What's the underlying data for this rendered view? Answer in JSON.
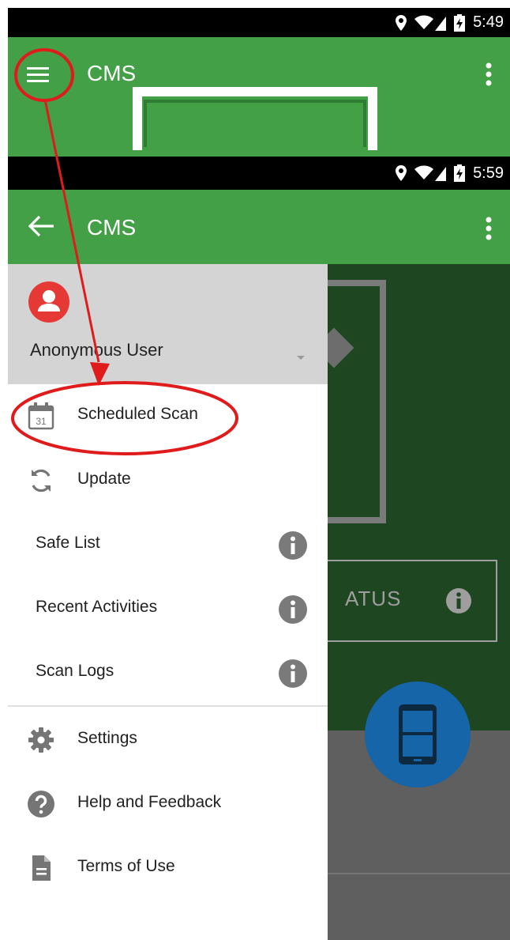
{
  "screen_top": {
    "status_time": "5:49",
    "title": "CMS"
  },
  "screen_bottom": {
    "status_time": "5:59",
    "title": "CMS",
    "background_status_text": "ATUS"
  },
  "drawer": {
    "user_name": "Anonymous User",
    "calendar_day": "31",
    "items": [
      {
        "label": "Scheduled Scan",
        "icon": "calendar-icon"
      },
      {
        "label": "Update",
        "icon": "refresh-icon"
      },
      {
        "label": "Safe List",
        "icon": "info-icon"
      },
      {
        "label": "Recent Activities",
        "icon": "info-icon"
      },
      {
        "label": "Scan Logs",
        "icon": "info-icon"
      },
      {
        "label": "Settings",
        "icon": "gear-icon"
      },
      {
        "label": "Help and Feedback",
        "icon": "help-icon"
      },
      {
        "label": "Terms of Use",
        "icon": "document-icon"
      }
    ]
  },
  "colors": {
    "appbar": "#43a047",
    "annotation": "#e01b1b",
    "avatar": "#e53935",
    "fab": "#1565a8"
  }
}
